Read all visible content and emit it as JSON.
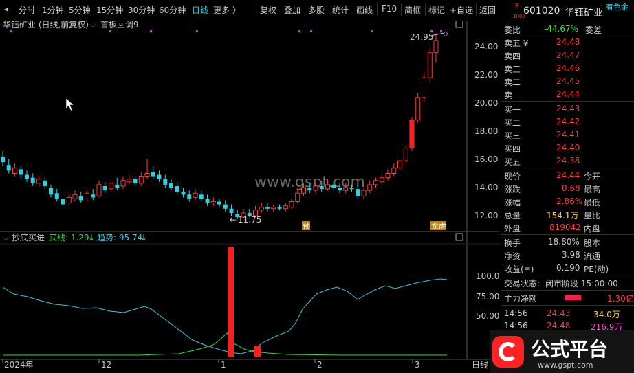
{
  "toolbar": {
    "items": [
      "分时",
      "1分钟",
      "5分钟",
      "15分钟",
      "30分钟",
      "60分钟",
      "日线",
      "更多 〉"
    ],
    "right_items": [
      "复权",
      "叠加",
      "多股",
      "统计",
      "画线",
      "F10",
      "简框",
      "标记",
      "+自选",
      "返回"
    ]
  },
  "chart": {
    "title": "华钰矿业 (日线,前复权)",
    "formula": "首板回调9",
    "y_ticks": [
      "24.00",
      "22.00",
      "20.00",
      "18.00",
      "16.00",
      "14.00",
      "12.00"
    ],
    "high_label": "24.95",
    "low_label": "11.75",
    "tag_yu": "预",
    "tag_longhu": "龙虎",
    "watermark_text": "www.gspt.com",
    "x_labels": [
      "2024年",
      "12",
      "1",
      "2",
      "3"
    ],
    "x_right": "日线"
  },
  "indicator": {
    "name": "抄底买进",
    "line1_label": "底线: 1.29",
    "line2_label": "趋势: 95.74",
    "y_ticks": [
      "100.0",
      "75.00",
      "50.00"
    ]
  },
  "sidebar": {
    "stock_code": "601020",
    "stock_name": "华钰矿业",
    "badge_r": "R",
    "badge_num": "1000",
    "corner": "有色金",
    "webi_label": "委比",
    "webi_value": "-44.67%",
    "weicha_label": "委差",
    "asks": [
      {
        "label": "卖五 ¥",
        "price": "24.48"
      },
      {
        "label": "卖四",
        "price": "24.47"
      },
      {
        "label": "卖三",
        "price": "24.46"
      },
      {
        "label": "卖二",
        "price": "24.45"
      },
      {
        "label": "卖一",
        "price": "24.44"
      }
    ],
    "bids": [
      {
        "label": "买一",
        "price": "24.43"
      },
      {
        "label": "买二",
        "price": "24.42"
      },
      {
        "label": "买三",
        "price": "24.41"
      },
      {
        "label": "买四",
        "price": "24.40"
      },
      {
        "label": "买五",
        "price": "24.38"
      }
    ],
    "stats": [
      {
        "label": "现价",
        "value": "24.44",
        "right": "今开",
        "color": "red"
      },
      {
        "label": "涨跌",
        "value": "0.68",
        "right": "最高",
        "color": "red"
      },
      {
        "label": "涨幅",
        "value": "2.86%",
        "right": "最低",
        "color": "red"
      },
      {
        "label": "总量",
        "value": "154.1万",
        "right": "量比",
        "color": "yellow"
      },
      {
        "label": "外盘",
        "value": "819042",
        "right": "内盘",
        "color": "red"
      }
    ],
    "stats2": [
      {
        "label": "换手",
        "value": "18.80%",
        "right": "股本"
      },
      {
        "label": "净资",
        "value": "3.98",
        "right": "流通"
      },
      {
        "label": "收益(≡)",
        "value": "0.190",
        "right": "PE(动)"
      }
    ],
    "trade_status_label": "交易状态:",
    "trade_status_value": "闭市阶段 15:00:00",
    "main_net_label": "主力净额",
    "main_net_value": "1.30亿",
    "ticks": [
      {
        "time": "14:56",
        "price": "24.43",
        "vol": "34.0万"
      },
      {
        "time": "14:56",
        "price": "24.48",
        "vol": "216.9万"
      }
    ]
  },
  "brand": {
    "name": "公式平台",
    "url": "www.gspt.com"
  },
  "colors": {
    "up": "#ff3b3b",
    "down": "#2fd0e0",
    "cyan_line": "#3ac6e0",
    "green_line": "#37d637",
    "accent": "#2fd0e0"
  }
}
